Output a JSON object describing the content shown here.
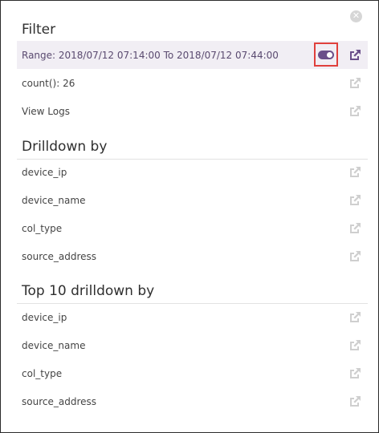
{
  "filter": {
    "title": "Filter",
    "range_label": "Range: 2018/07/12 07:14:00 To 2018/07/12 07:44:00",
    "count_label": "count(): 26",
    "view_logs_label": "View Logs"
  },
  "drilldown": {
    "title": "Drilldown by",
    "items": [
      "device_ip",
      "device_name",
      "col_type",
      "source_address"
    ]
  },
  "top10": {
    "title": "Top 10 drilldown by",
    "items": [
      "device_ip",
      "device_name",
      "col_type",
      "source_address"
    ]
  },
  "colors": {
    "accent": "#6a4f8a",
    "highlight_border": "#e0403c",
    "range_bg": "#f1eef4",
    "muted_icon": "#cfcfcf"
  },
  "icons": {
    "close": "close-circle-icon",
    "external": "external-link-icon",
    "toggle": "toggle-switch-icon"
  }
}
